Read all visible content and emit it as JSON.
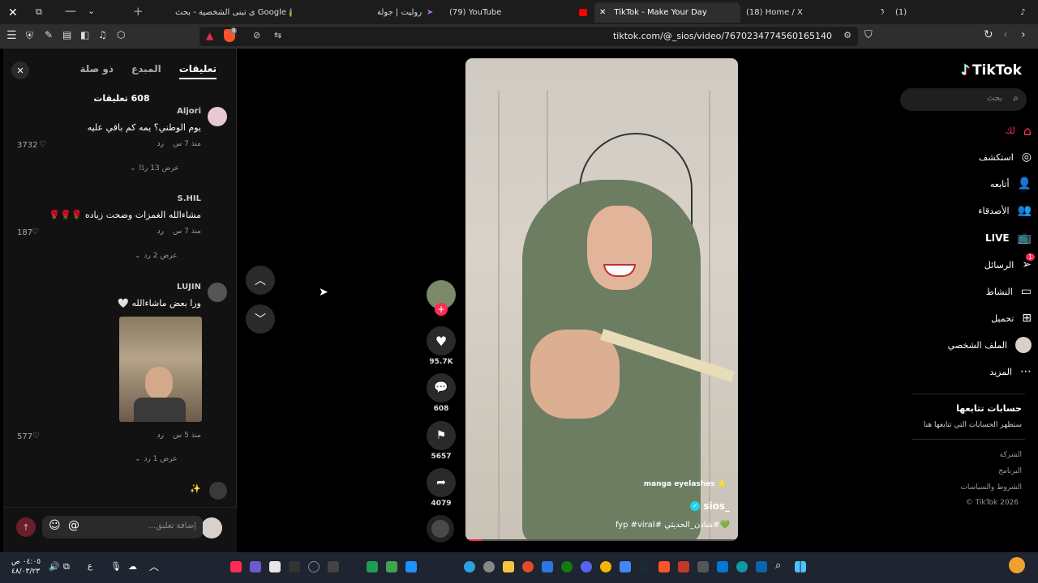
{
  "browser": {
    "tabs": [
      {
        "label": "ى تبنى الشخصية - بحث Google"
      },
      {
        "label": "روليت | جولة"
      },
      {
        "label": "(79) YouTube"
      },
      {
        "label": "TikTok - Make Your Day"
      },
      {
        "label": "(18) Home / X"
      },
      {
        "label": "(1)"
      }
    ],
    "url": "tiktok.com/@_sios/video/7670234774560165140",
    "shield_badge": "8"
  },
  "tiktok": {
    "logo": "TikTok",
    "search_placeholder": "بحث",
    "nav": [
      {
        "label": "لك",
        "icon": "home-icon"
      },
      {
        "label": "استكشف",
        "icon": "compass-icon"
      },
      {
        "label": "أتابعه",
        "icon": "user-follow-icon"
      },
      {
        "label": "الأصدقاء",
        "icon": "friends-icon"
      },
      {
        "label": "LIVE",
        "icon": "live-icon"
      },
      {
        "label": "الرسائل",
        "icon": "send-icon"
      },
      {
        "label": "النشاط",
        "icon": "activity-icon"
      },
      {
        "label": "تحميل",
        "icon": "upload-icon"
      },
      {
        "label": "الملف الشخصي",
        "icon": "avatar-icon"
      },
      {
        "label": "المزيد",
        "icon": "more-icon"
      }
    ],
    "messages_badge": "1",
    "following_title": "حسابات تتابعها",
    "following_hint": "ستظهر الحسابات التي تتابعها هنا",
    "footer": [
      "الشركة",
      "البرنامج",
      "الشروط والسياسات",
      "© TikTok 2026"
    ],
    "accent": "#fe2c55"
  },
  "video": {
    "username": "sios_",
    "caption": "💚#شادن_الحديثي #fyp #viral",
    "sticker": "manga eyelashes ⭐",
    "likes": "95.7K",
    "comments": "608",
    "saves": "5657",
    "shares": "4079"
  },
  "comments_panel": {
    "tabs": [
      "تعليقات",
      "المبدع",
      "ذو صلة"
    ],
    "count_label": "608 تعليقات",
    "reply_label": "رد",
    "items": [
      {
        "user": "Aljori",
        "text": "يوم الوطني؟ يمه كم باقي عليه",
        "time": "منذ 7 س",
        "likes": "3732",
        "replies": "عرض 13 ردًا"
      },
      {
        "user": "S.HIL",
        "text": "مشاءالله الغمزات وضحت زياده 🌹🌹🌹",
        "time": "منذ 7 س",
        "likes": "187",
        "replies": "عرض 2 رد"
      },
      {
        "user": "LUJIN",
        "text": "ورا بعض ماشاءالله 🤍",
        "time": "منذ 5 س",
        "likes": "577",
        "replies": "عرض 1 رد"
      },
      {
        "user": "",
        "text": "✨",
        "time": "",
        "likes": "",
        "replies": ""
      }
    ],
    "input_placeholder": "إضافة تعليق..."
  },
  "taskbar": {
    "clock_time": "٠٤:٠٥ ص",
    "clock_date": "٤٨/٠٣/٢٣",
    "lang": "ع"
  }
}
